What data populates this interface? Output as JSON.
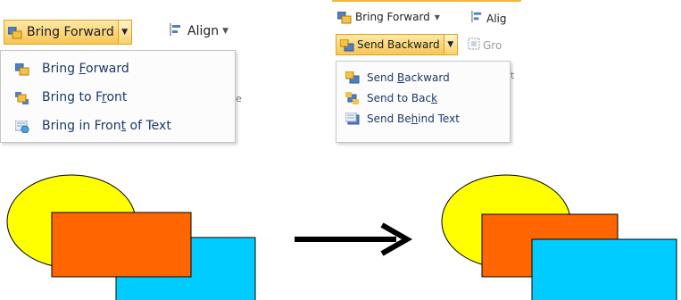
{
  "panel_left": {
    "bring_forward_button": "Bring Forward",
    "align_button": "Align",
    "menu": [
      {
        "label_pre": "Bring ",
        "label_u": "F",
        "label_post": "orward",
        "icon": "bring-forward-icon"
      },
      {
        "label_pre": "Bring to F",
        "label_u": "r",
        "label_post": "ont",
        "icon": "bring-to-front-icon"
      },
      {
        "label_pre": "Bring in Fron",
        "label_u": "t",
        "label_post": " of Text",
        "icon": "bring-in-front-of-text-icon"
      }
    ]
  },
  "panel_right": {
    "bring_forward_button": "Bring Forward",
    "align_partial": "Alig",
    "group_partial": "Gro",
    "send_backward_button": "Send Backward",
    "menu": [
      {
        "label_pre": "Send ",
        "label_u": "B",
        "label_post": "ackward",
        "icon": "send-backward-icon"
      },
      {
        "label_pre": "Send to Bac",
        "label_u": "k",
        "label_post": "",
        "icon": "send-to-back-icon"
      },
      {
        "label_pre": "Send Be",
        "label_u": "h",
        "label_post": "ind Text",
        "icon": "send-behind-text-icon"
      }
    ]
  },
  "colors": {
    "ellipse": "#ffff00",
    "orange_rect": "#ff6600",
    "blue_rect": "#00ccff",
    "accent": "#f3b63c"
  }
}
